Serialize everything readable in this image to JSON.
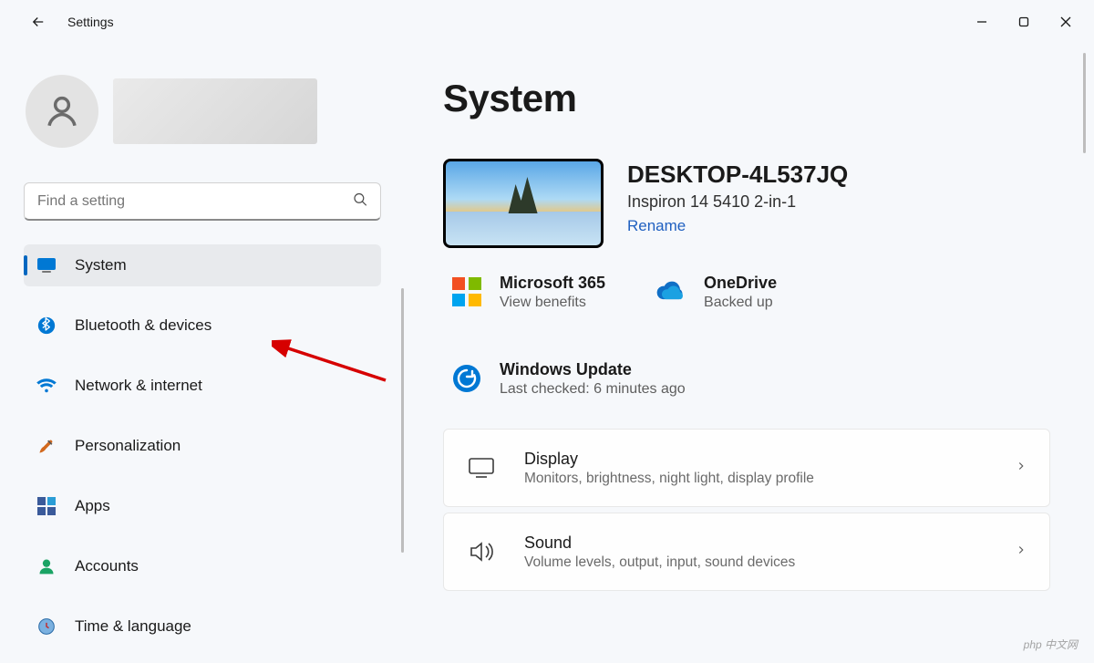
{
  "title": "Settings",
  "search": {
    "placeholder": "Find a setting"
  },
  "user": {
    "name": ""
  },
  "nav": [
    {
      "id": "system",
      "label": "System"
    },
    {
      "id": "bluetooth",
      "label": "Bluetooth & devices"
    },
    {
      "id": "network",
      "label": "Network & internet"
    },
    {
      "id": "personalization",
      "label": "Personalization"
    },
    {
      "id": "apps",
      "label": "Apps"
    },
    {
      "id": "accounts",
      "label": "Accounts"
    },
    {
      "id": "time",
      "label": "Time & language"
    }
  ],
  "main": {
    "heading": "System",
    "device": {
      "name": "DESKTOP-4L537JQ",
      "model": "Inspiron 14 5410 2-in-1",
      "rename": "Rename"
    },
    "status": {
      "m365": {
        "title": "Microsoft 365",
        "sub": "View benefits"
      },
      "onedrive": {
        "title": "OneDrive",
        "sub": "Backed up"
      },
      "wu": {
        "title": "Windows Update",
        "sub": "Last checked: 6 minutes ago"
      }
    },
    "cards": [
      {
        "id": "display",
        "title": "Display",
        "sub": "Monitors, brightness, night light, display profile"
      },
      {
        "id": "sound",
        "title": "Sound",
        "sub": "Volume levels, output, input, sound devices"
      }
    ]
  },
  "watermark": "php 中文网"
}
